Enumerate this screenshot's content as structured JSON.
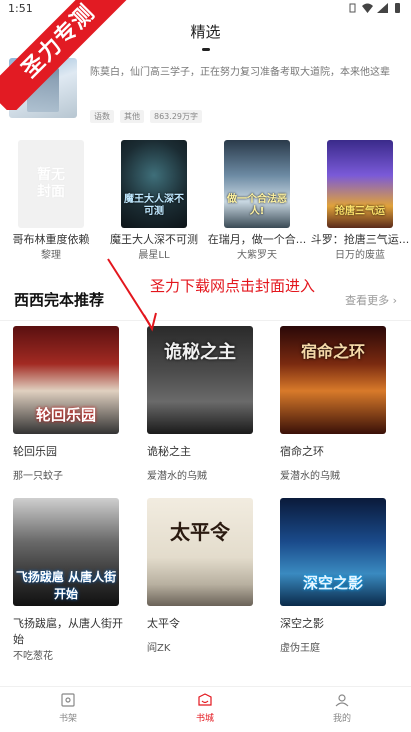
{
  "status": {
    "time": "1:51"
  },
  "ribbon": {
    "text": "圣力专测"
  },
  "header": {
    "title": "精选"
  },
  "top_book": {
    "desc": "陈莫白，仙门高三学子，正在努力复习准备考取大道院，本来他这辈子...",
    "tags": [
      "语数",
      "其他",
      "863.29万字"
    ]
  },
  "row4": [
    {
      "name": "哥布林重度依赖",
      "author": "黎理",
      "cover": "暂无封面"
    },
    {
      "name": "魔王大人深不可测",
      "author": "晨星LL",
      "cover": "魔王大人深不可测"
    },
    {
      "name": "在瑞月，做一个合...",
      "author": "大紫罗天",
      "cover": "做一个合法恶人!"
    },
    {
      "name": "斗罗：抢唐三气运...",
      "author": "日万的废蓝",
      "cover": "抢唐三气运"
    }
  ],
  "annotation": {
    "text": "圣力下载网点击封面进入"
  },
  "section": {
    "title": "西西完本推荐",
    "more": "查看更多"
  },
  "grid": [
    {
      "name": "轮回乐园",
      "author": "那一只蚊子",
      "cover": "轮回乐园"
    },
    {
      "name": "诡秘之主",
      "author": "爱潜水的乌贼",
      "cover": "诡秘之主"
    },
    {
      "name": "宿命之环",
      "author": "爱潜水的乌贼",
      "cover": "宿命之环"
    },
    {
      "name": "飞扬跋扈，从唐人街开始",
      "author": "不吃葱花",
      "cover": "飞扬跋扈 从唐人街开始"
    },
    {
      "name": "太平令",
      "author": "阎ZK",
      "cover": "太平令"
    },
    {
      "name": "深空之影",
      "author": "虚伪王庭",
      "cover": "深空之影"
    }
  ],
  "nav": [
    {
      "label": "书架",
      "icon": "bookshelf-icon"
    },
    {
      "label": "书城",
      "icon": "bookstore-icon"
    },
    {
      "label": "我的",
      "icon": "profile-icon"
    }
  ],
  "colors": {
    "accent": "#e3161d",
    "ribbon": "#e21b23"
  }
}
